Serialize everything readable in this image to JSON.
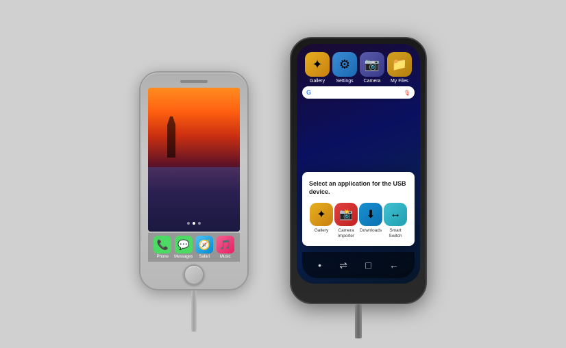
{
  "scene": {
    "background": "#d0d0d0"
  },
  "iphone": {
    "apps": [
      {
        "id": "phone",
        "label": "Phone",
        "class": "phone-icon",
        "icon": "📞"
      },
      {
        "id": "messages",
        "label": "Messages",
        "class": "messages-icon",
        "icon": "💬"
      },
      {
        "id": "safari",
        "label": "Safari",
        "class": "safari-icon",
        "icon": "🧭"
      },
      {
        "id": "music",
        "label": "Music",
        "class": "music-icon",
        "icon": "🎵"
      }
    ]
  },
  "samsung": {
    "top_apps": [
      {
        "id": "gallery",
        "label": "Gallery",
        "class": "gallery-s",
        "icon": "✦"
      },
      {
        "id": "settings",
        "label": "Settings",
        "class": "settings-s",
        "icon": "⚙"
      },
      {
        "id": "camera",
        "label": "Camera",
        "class": "camera-s",
        "icon": "📷"
      },
      {
        "id": "myfiles",
        "label": "My Files",
        "class": "myfiles-s",
        "icon": "📁"
      }
    ],
    "dialog": {
      "title": "Select an application for the USB device.",
      "apps": [
        {
          "id": "gallery",
          "label": "Gallery",
          "class": "d-gallery",
          "icon": "✦"
        },
        {
          "id": "camera-importer",
          "label": "Camera\nImporter",
          "class": "d-camera",
          "icon": "📸"
        },
        {
          "id": "downloads",
          "label": "Downloads",
          "class": "d-downloads",
          "icon": "⬇"
        },
        {
          "id": "smart-switch",
          "label": "Smart Switch",
          "class": "d-smart-switch",
          "icon": "↔"
        }
      ]
    },
    "nav": {
      "items": [
        "•",
        "⇌",
        "□",
        "←"
      ]
    }
  }
}
